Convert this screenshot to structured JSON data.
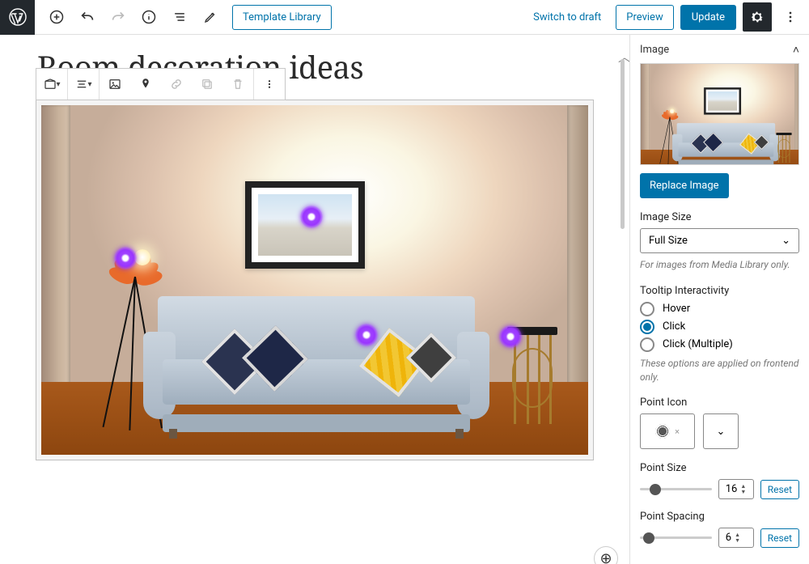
{
  "topbar": {
    "template_library": "Template Library",
    "switch_to_draft": "Switch to draft",
    "preview": "Preview",
    "update": "Update"
  },
  "page": {
    "title": "Room decoration ideas"
  },
  "sidebar": {
    "image_header": "Image",
    "replace_image": "Replace Image",
    "image_size_label": "Image Size",
    "image_size_value": "Full Size",
    "image_size_help": "For images from Media Library only.",
    "tooltip_label": "Tooltip Interactivity",
    "tooltip_options": {
      "hover": "Hover",
      "click": "Click",
      "click_multiple": "Click (Multiple)"
    },
    "tooltip_selected": "click",
    "tooltip_help": "These options are applied on frontend only.",
    "point_icon_label": "Point Icon",
    "point_icon_x": "×",
    "point_size_label": "Point Size",
    "point_size_value": "16",
    "point_spacing_label": "Point Spacing",
    "point_spacing_value": "6",
    "reset": "Reset"
  }
}
